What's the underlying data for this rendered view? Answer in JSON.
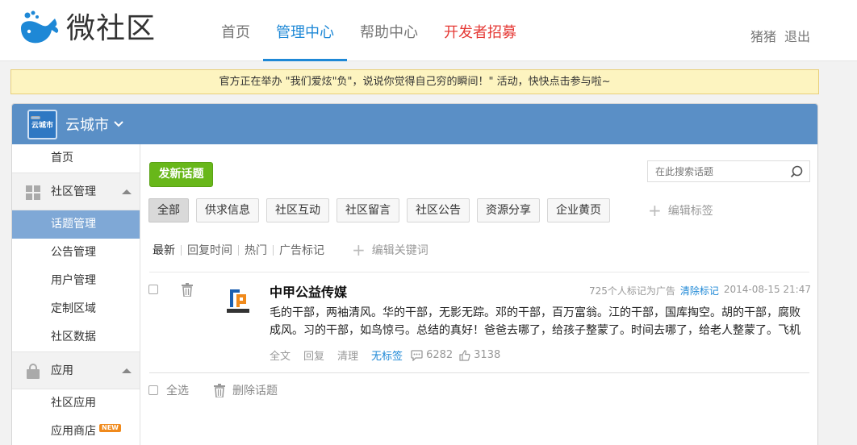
{
  "app": {
    "logo_text": "微社区",
    "logo_icon": "whale-icon"
  },
  "nav": {
    "items": [
      {
        "label": "首页"
      },
      {
        "label": "管理中心"
      },
      {
        "label": "帮助中心"
      },
      {
        "label": "开发者招募"
      }
    ],
    "active_index": 1
  },
  "user": {
    "name": "猪猪",
    "logout": "退出"
  },
  "notice": {
    "text": "官方正在举办 \"我们爱炫\"负\"，说说你觉得自己穷的瞬间！\" 活动，快快点击参与啦~"
  },
  "community": {
    "name": "云城市",
    "avatar_text": "云城市"
  },
  "sidebar": {
    "home": "首页",
    "group_community": "社区管理",
    "community_items": [
      {
        "label": "话题管理"
      },
      {
        "label": "公告管理"
      },
      {
        "label": "用户管理"
      },
      {
        "label": "定制区域"
      },
      {
        "label": "社区数据"
      }
    ],
    "active_item": "话题管理",
    "group_apps": "应用",
    "app_items": [
      {
        "label": "社区应用"
      },
      {
        "label": "应用商店"
      }
    ],
    "new_badge": "NEW"
  },
  "toolbar": {
    "new_topic": "发新话题",
    "search_placeholder": "在此搜索话题"
  },
  "tags": {
    "items": [
      "全部",
      "供求信息",
      "社区互动",
      "社区留言",
      "社区公告",
      "资源分享",
      "企业黄页"
    ],
    "active_index": 0,
    "edit_label": "编辑标签"
  },
  "filters": {
    "items": [
      "最新",
      "回复时间",
      "热门",
      "广告标记"
    ],
    "edit_keywords": "编辑关键词"
  },
  "post": {
    "author": "中甲公益传媒",
    "avatar_label": "中甲传媒",
    "marked_as_ad": "725个人标记为广告",
    "clear_mark": "清除标记",
    "time": "2014-08-15 21:47",
    "body": "毛的干部，两袖清风。华的干部，无影无踪。邓的干部，百万富翁。江的干部，国库掏空。胡的干部，腐败成风。习的干部，如鸟惊弓。总结的真好！爸爸去哪了，给孩子整蒙了。时间去哪了，给老人整蒙了。飞机",
    "actions": {
      "full": "全文",
      "reply": "回复",
      "clean": "清理",
      "tag": "无标签"
    },
    "comments": "6282",
    "likes": "3138"
  },
  "bulk": {
    "select_all": "全选",
    "delete": "删除话题"
  },
  "colors": {
    "accent_blue": "#1e88d6",
    "header_blue": "#5a8fc6",
    "green_button": "#68b71a",
    "nav_red": "#e53935"
  }
}
